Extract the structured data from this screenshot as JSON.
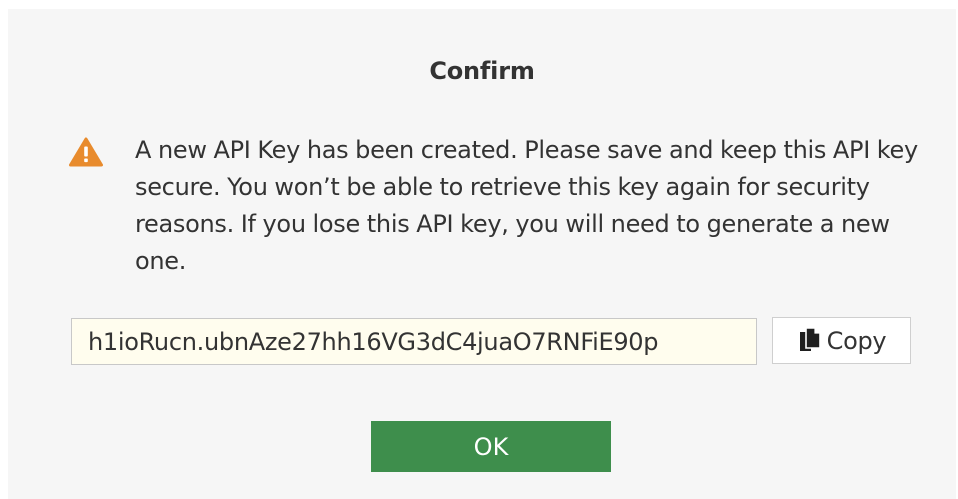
{
  "dialog": {
    "title": "Confirm",
    "icon": "warning-icon",
    "message": "A new API Key has been created. Please save and keep this API key secure. You won’t be able to retrieve this key again for security reasons. If you lose this API key, you will need to generate a new one.",
    "api_key_value": "h1ioRucn.ubnAze27hh16VG3dC4juaO7RNFiE90p",
    "copy_label": "Copy",
    "ok_label": "OK"
  },
  "colors": {
    "dialog_background": "#f6f6f6",
    "warning_orange": "#e88b2d",
    "ok_green": "#3e8e4c",
    "key_field_background": "#fffdee",
    "text": "#333333"
  }
}
